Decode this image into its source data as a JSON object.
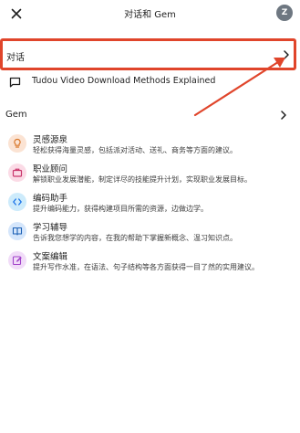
{
  "header": {
    "title": "对话和 Gem",
    "avatar_initial": "Z"
  },
  "conversations": {
    "section_label": "对话",
    "items": [
      {
        "label": "Tudou Video Download Methods Explained"
      }
    ]
  },
  "gems": {
    "section_label": "Gem",
    "items": [
      {
        "title": "灵感源泉",
        "desc": "轻松获得海量灵感，包括派对活动、送礼、商务等方面的建议。",
        "icon": "lightbulb-icon",
        "bg": "#fbe3d3",
        "fg": "#d9782b"
      },
      {
        "title": "职业顾问",
        "desc": "解锁职业发展潜能，制定详尽的技能提升计划，实现职业发展目标。",
        "icon": "briefcase-icon",
        "bg": "#fbdbe6",
        "fg": "#c9356b"
      },
      {
        "title": "编码助手",
        "desc": "提升编码能力，获得构建项目所需的资源，边做边学。",
        "icon": "code-icon",
        "bg": "#cdebfb",
        "fg": "#1a73e8"
      },
      {
        "title": "学习辅导",
        "desc": "告诉我您想学的内容，在我的帮助下掌握新概念、温习知识点。",
        "icon": "book-icon",
        "bg": "#d5e6fb",
        "fg": "#1a5fb4"
      },
      {
        "title": "文案编辑",
        "desc": "提升写作水准，在语法、句子结构等各方面获得一目了然的实用建议。",
        "icon": "edit-icon",
        "bg": "#f1dcf8",
        "fg": "#a142c9"
      }
    ]
  },
  "colors": {
    "highlight": "#e0452b",
    "text": "#1f1f1f",
    "avatar_bg": "#6e7781"
  }
}
